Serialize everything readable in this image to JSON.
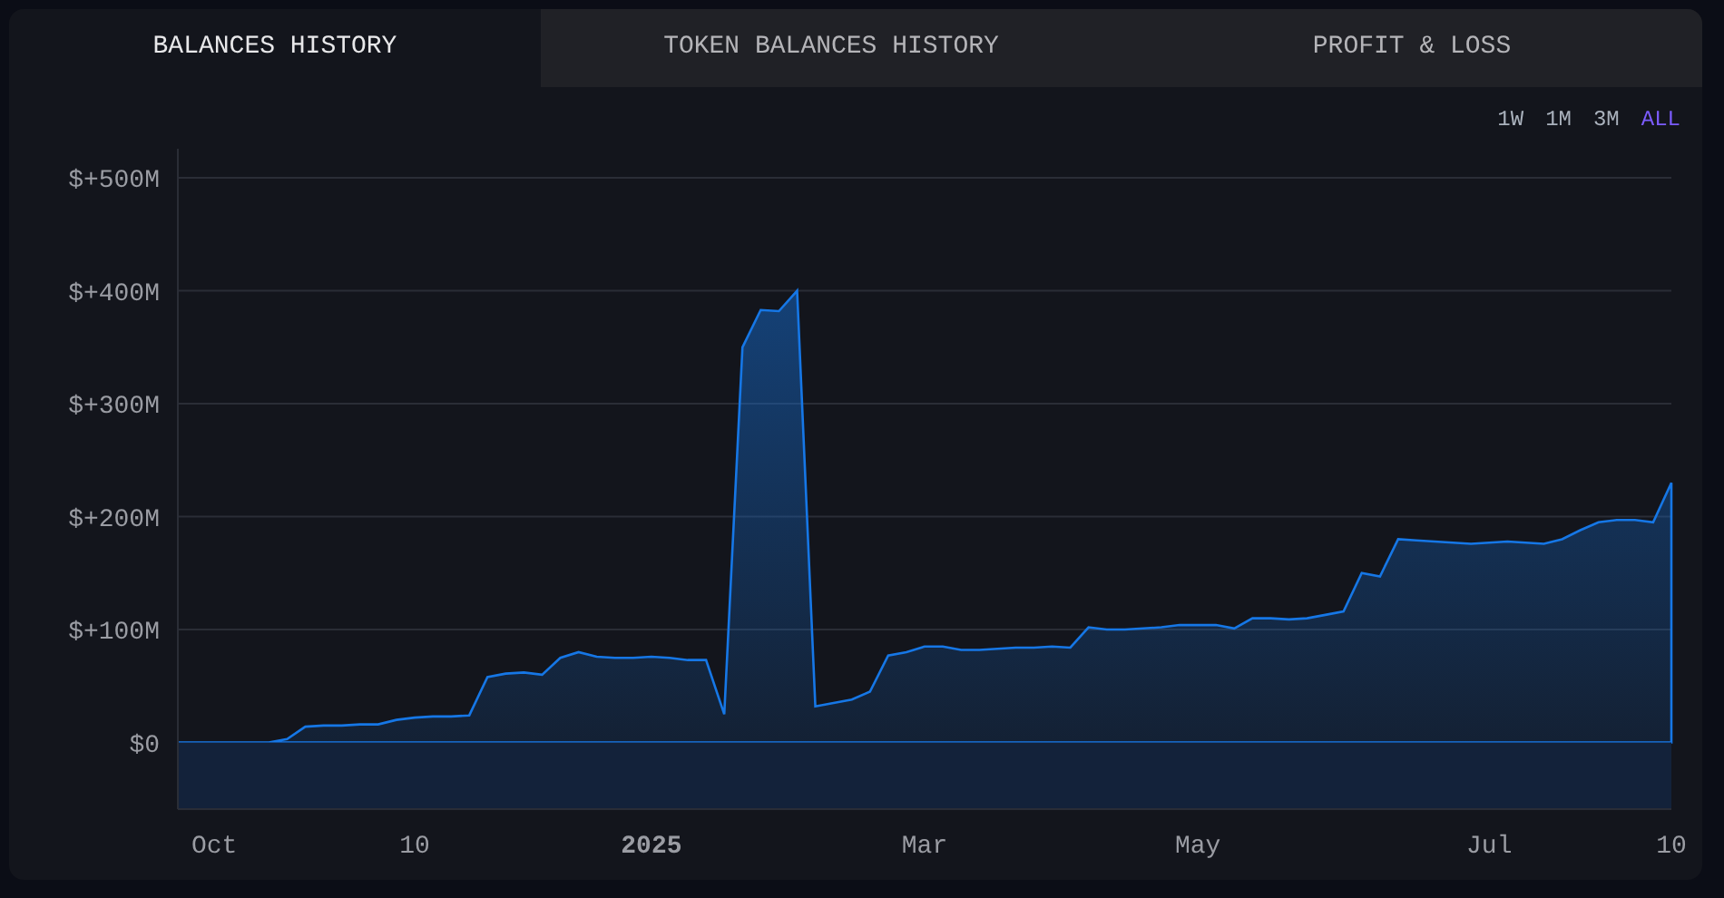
{
  "tabs": [
    {
      "label": "BALANCES HISTORY",
      "selected": true
    },
    {
      "label": "TOKEN BALANCES HISTORY",
      "selected": false
    },
    {
      "label": "PROFIT & LOSS",
      "selected": false
    }
  ],
  "ranges": [
    {
      "label": "1W",
      "selected": false
    },
    {
      "label": "1M",
      "selected": false
    },
    {
      "label": "3M",
      "selected": false
    },
    {
      "label": "ALL",
      "selected": true
    }
  ],
  "chart_data": {
    "type": "area",
    "categories": [
      null,
      null,
      "Oct",
      null,
      null,
      null,
      null,
      null,
      null,
      null,
      null,
      null,
      null,
      "10",
      null,
      null,
      null,
      null,
      null,
      null,
      null,
      null,
      null,
      null,
      null,
      null,
      "2025",
      null,
      null,
      null,
      null,
      null,
      null,
      null,
      null,
      null,
      null,
      null,
      null,
      null,
      null,
      "Mar",
      null,
      null,
      null,
      null,
      null,
      null,
      null,
      null,
      null,
      null,
      null,
      null,
      null,
      null,
      "May",
      null,
      null,
      null,
      null,
      null,
      null,
      null,
      null,
      null,
      null,
      null,
      null,
      null,
      null,
      null,
      "Jul",
      null,
      null,
      null,
      null,
      null,
      null,
      null,
      null,
      null,
      "10"
    ],
    "series": [
      {
        "color": "#1677e6",
        "values": [
          0,
          0,
          0,
          0,
          0,
          0,
          3,
          14,
          15,
          15,
          16,
          16,
          20,
          22,
          23,
          23,
          24,
          58,
          61,
          62,
          60,
          75,
          80,
          76,
          75,
          75,
          76,
          75,
          73,
          73,
          25,
          350,
          383,
          382,
          400,
          32,
          35,
          38,
          45,
          77,
          80,
          85,
          85,
          82,
          82,
          83,
          84,
          84,
          85,
          84,
          102,
          100,
          100,
          101,
          102,
          104,
          104,
          104,
          101,
          110,
          110,
          109,
          110,
          113,
          116,
          150,
          147,
          180,
          179,
          178,
          177,
          176,
          177,
          178,
          177,
          176,
          180,
          188,
          195,
          197,
          197,
          195,
          230
        ]
      }
    ],
    "ylim": [
      -59,
      529
    ],
    "grid": true,
    "yticks": [
      {
        "value": 0,
        "label": "$0"
      },
      {
        "value": 100,
        "label": "$+100M"
      },
      {
        "value": 200,
        "label": "$+200M"
      },
      {
        "value": 300,
        "label": "$+300M"
      },
      {
        "value": 400,
        "label": "$+400M"
      },
      {
        "value": 500,
        "label": "$+500M"
      }
    ]
  }
}
